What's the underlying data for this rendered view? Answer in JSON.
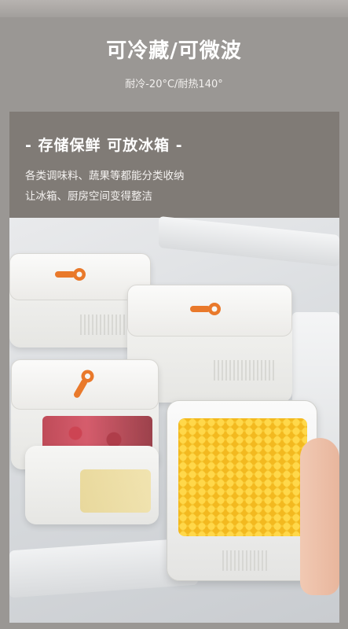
{
  "header": {
    "title": "可冷藏/可微波",
    "subtitle": "耐冷-20°C/耐热140°"
  },
  "feature": {
    "title": "- 存储保鲜 可放冰箱 -",
    "line1": "各类调味料、蔬果等都能分类收纳",
    "line2": "让冰箱、厨房空间变得整洁"
  },
  "colors": {
    "accent_orange": "#e9792b",
    "panel_dark": "#807b76",
    "background": "#9a9794"
  }
}
